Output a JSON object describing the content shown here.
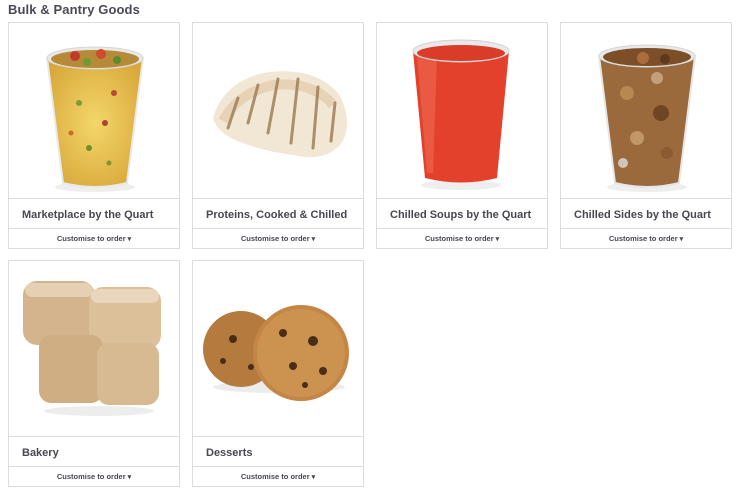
{
  "section": {
    "title": "Bulk & Pantry Goods"
  },
  "products": [
    {
      "name": "Marketplace by the Quart",
      "cta": "Customise to order",
      "image": "corn-salad-quart-image"
    },
    {
      "name": "Proteins, Cooked & Chilled",
      "cta": "Customise to order",
      "image": "grilled-chicken-image"
    },
    {
      "name": "Chilled Soups by the Quart",
      "cta": "Customise to order",
      "image": "tomato-soup-quart-image"
    },
    {
      "name": "Chilled Sides by the Quart",
      "cta": "Customise to order",
      "image": "roasted-sides-quart-image"
    },
    {
      "name": "Bakery",
      "cta": "Customise to order",
      "image": "bread-rolls-image"
    },
    {
      "name": "Desserts",
      "cta": "Customise to order",
      "image": "cookies-image"
    }
  ],
  "icons": {
    "cta_arrow": "arrow-down-icon"
  }
}
